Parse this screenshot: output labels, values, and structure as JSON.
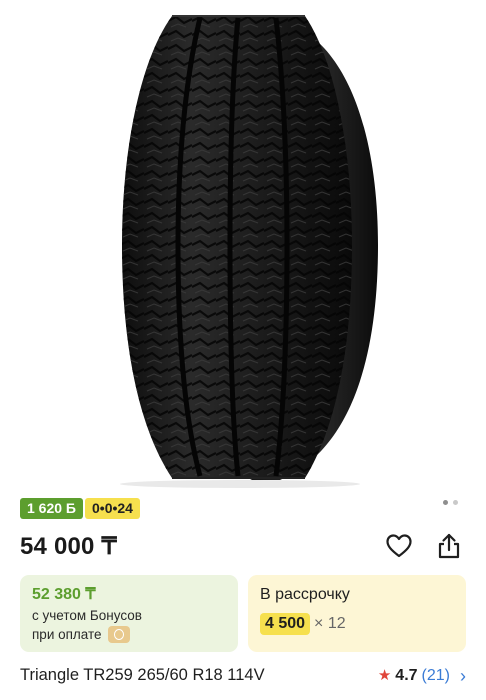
{
  "badges": {
    "bonus": "1 620 Б",
    "credit": "0•0•24"
  },
  "price": "54 000 ₸",
  "bonus_card": {
    "price": "52 380 ₸",
    "line1": "с учетом Бонусов",
    "line2": "при оплате"
  },
  "installment_card": {
    "title": "В рассрочку",
    "amount": "4 500",
    "multiplier": "× 12"
  },
  "product": {
    "title": "Triangle TR259 265/60 R18 114V",
    "rating": "4.7",
    "reviews": "(21)"
  },
  "icons": {
    "favorite": "heart-icon",
    "share": "share-icon",
    "rating": "star-icon",
    "more": "chevron-right-icon"
  },
  "colors": {
    "bonus_green": "#5c9e2e",
    "credit_yellow": "#f6e04e",
    "link_blue": "#3a7bd5",
    "star_red": "#e0453a"
  }
}
